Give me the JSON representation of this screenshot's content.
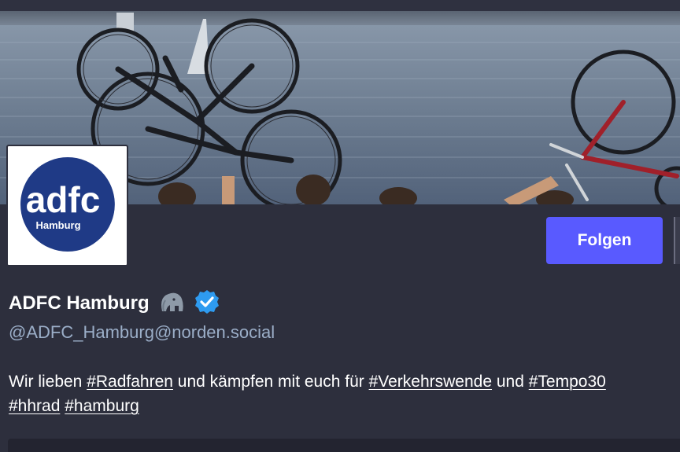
{
  "profile": {
    "avatar_text": "adfc",
    "avatar_subtext": "Hamburg",
    "display_name": "ADFC Hamburg",
    "handle": "@ADFC_Hamburg@norden.social",
    "verified_icon": "verified-check-icon",
    "mastodon_icon": "mastodon-elephant-icon"
  },
  "actions": {
    "follow_label": "Folgen"
  },
  "bio": {
    "line1_text1": "Wir lieben ",
    "tag_radfahren": "#Radfahren",
    "line1_text2": " und kämpfen mit euch für ",
    "tag_verkehrswende": "#Verkehrswende",
    "line1_text3": " und ",
    "tag_tempo30": "#Tempo30",
    "tag_hhrad": "#hhrad",
    "tag_hamburg": "#hamburg"
  },
  "colors": {
    "background": "#2d2f3d",
    "accent": "#595aff",
    "muted": "#9baec8",
    "verified": "#2e9bf0"
  }
}
